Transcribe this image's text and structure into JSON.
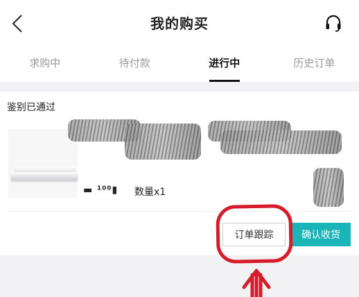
{
  "header": {
    "title": "我的购买",
    "back_icon": "chevron-left-icon",
    "support_icon": "headset-icon"
  },
  "tabs": [
    {
      "label": "求购中",
      "active": false
    },
    {
      "label": "待付款",
      "active": false
    },
    {
      "label": "进行中",
      "active": true
    },
    {
      "label": "历史订单",
      "active": false
    }
  ],
  "order": {
    "status": "鉴别已通过",
    "obscured_text": "▬ ¹⁰⁰▮",
    "quantity": "数量x1",
    "buttons": {
      "track": "订单跟踪",
      "confirm": "确认收货"
    }
  },
  "colors": {
    "accent": "#1ab5b8",
    "annotation": "#d61c2b",
    "background": "#f2f2f4"
  }
}
